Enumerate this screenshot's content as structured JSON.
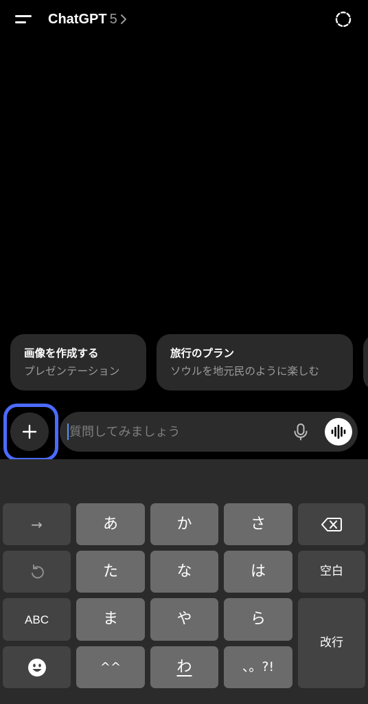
{
  "header": {
    "title": "ChatGPT",
    "model": "5",
    "icons": {
      "menu": "menu-icon",
      "model_chevron": "chevron-right-icon",
      "temporary_chat": "temporary-chat-icon"
    }
  },
  "suggestions": [
    {
      "title": "画像を作成する",
      "subtitle": "プレゼンテーション"
    },
    {
      "title": "旅行のプラン",
      "subtitle": "ソウルを地元民のように楽しむ"
    }
  ],
  "composer": {
    "placeholder": "質問してみましょう",
    "value": "",
    "icons": {
      "add": "plus-icon",
      "dictate": "microphone-icon",
      "voice_mode": "voice-waveform-icon"
    },
    "highlight_color": "#4b6bff"
  },
  "keyboard": {
    "row1": [
      "→",
      "あ",
      "か",
      "さ",
      "⌫"
    ],
    "row2": [
      "↺",
      "た",
      "な",
      "は",
      "空白"
    ],
    "row3": [
      "ABC",
      "ま",
      "や",
      "ら"
    ],
    "row4": [
      "☻",
      "^^",
      "わ",
      "、。?!"
    ],
    "enter": "改行"
  },
  "colors": {
    "background": "#000000",
    "card": "#2a2a2a",
    "input": "#2c2c2c",
    "keyboard": "#2b2b2b",
    "key": "#6b6b6b",
    "function_key": "#434343"
  }
}
